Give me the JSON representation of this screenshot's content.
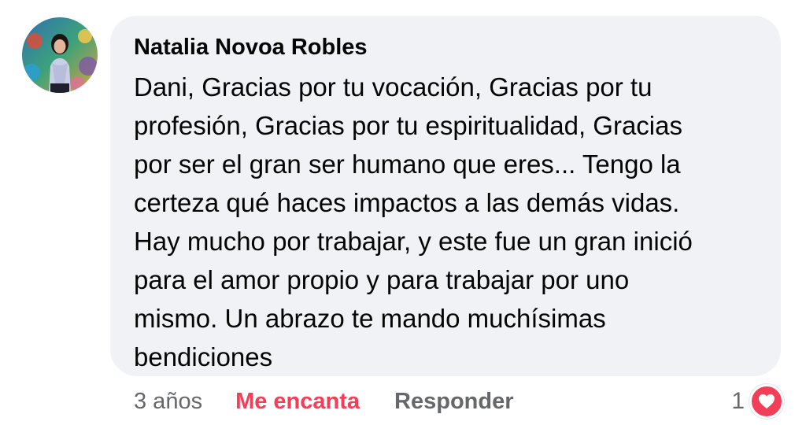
{
  "comment": {
    "author": "Natalia Novoa Robles",
    "lines": [
      "Dani, Gracias por tu vocación, Gracias por tu",
      "profesión, Gracias por tu espiritualidad, Gracias",
      "por ser el gran ser humano que eres... Tengo la",
      "certeza qué haces impactos a las demás vidas.",
      "Hay mucho por trabajar, y este fue un gran inició",
      "para el amor propio y para trabajar por uno",
      "mismo. Un abrazo te mando muchísimas",
      "bendiciones"
    ]
  },
  "actions": {
    "timestamp": "3 años",
    "love_label": "Me encanta",
    "reply_label": "Responder"
  },
  "reactions": {
    "count": "1",
    "icon": "heart-icon"
  },
  "colors": {
    "bubble_bg": "#f0f2f5",
    "love_red": "#f33e58",
    "secondary_text": "#65676b"
  }
}
